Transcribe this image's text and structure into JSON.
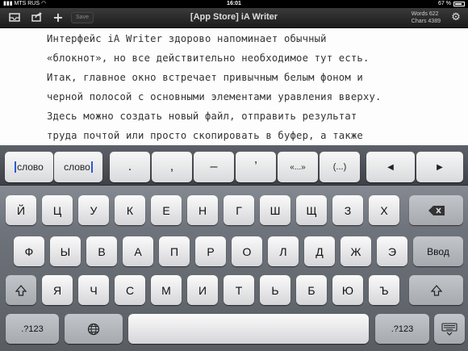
{
  "status": {
    "carrier": "MTS RUS",
    "time": "16:01",
    "battery": "67 %"
  },
  "toolbar": {
    "save_label": "Save",
    "title": "[App Store] iA Writer",
    "words": "Words  622",
    "chars": "Chars  4389"
  },
  "document": {
    "lines": [
      "Интерфейс iA Writer здорово напоминает обычный",
      "«блокнот», но все действительно необходимое тут есть.",
      "Итак, главное окно встречает привычным белым фоном и",
      "черной полосой с основными элементами уравления вверху.",
      "Здесь можно создать новый файл, отправить результат",
      "труда почтой или просто скопировать в буфер, а также"
    ]
  },
  "assist": {
    "word_left": "слово",
    "word_right": "слово",
    "period": ".",
    "comma": ",",
    "dash": "–",
    "apostrophe": "’",
    "quotes": "«...»",
    "parens": "(...)",
    "arrow_left": "◀",
    "arrow_right": "▶"
  },
  "keys": {
    "row1": [
      "Й",
      "Ц",
      "У",
      "К",
      "Е",
      "Н",
      "Г",
      "Ш",
      "Щ",
      "З",
      "Х"
    ],
    "row2": [
      "Ф",
      "Ы",
      "В",
      "А",
      "П",
      "Р",
      "О",
      "Л",
      "Д",
      "Ж",
      "Э"
    ],
    "row3": [
      "Я",
      "Ч",
      "С",
      "М",
      "И",
      "Т",
      "Ь",
      "Б",
      "Ю",
      "Ъ"
    ],
    "return_label": "Ввод",
    "numbers_label": ".?123"
  }
}
